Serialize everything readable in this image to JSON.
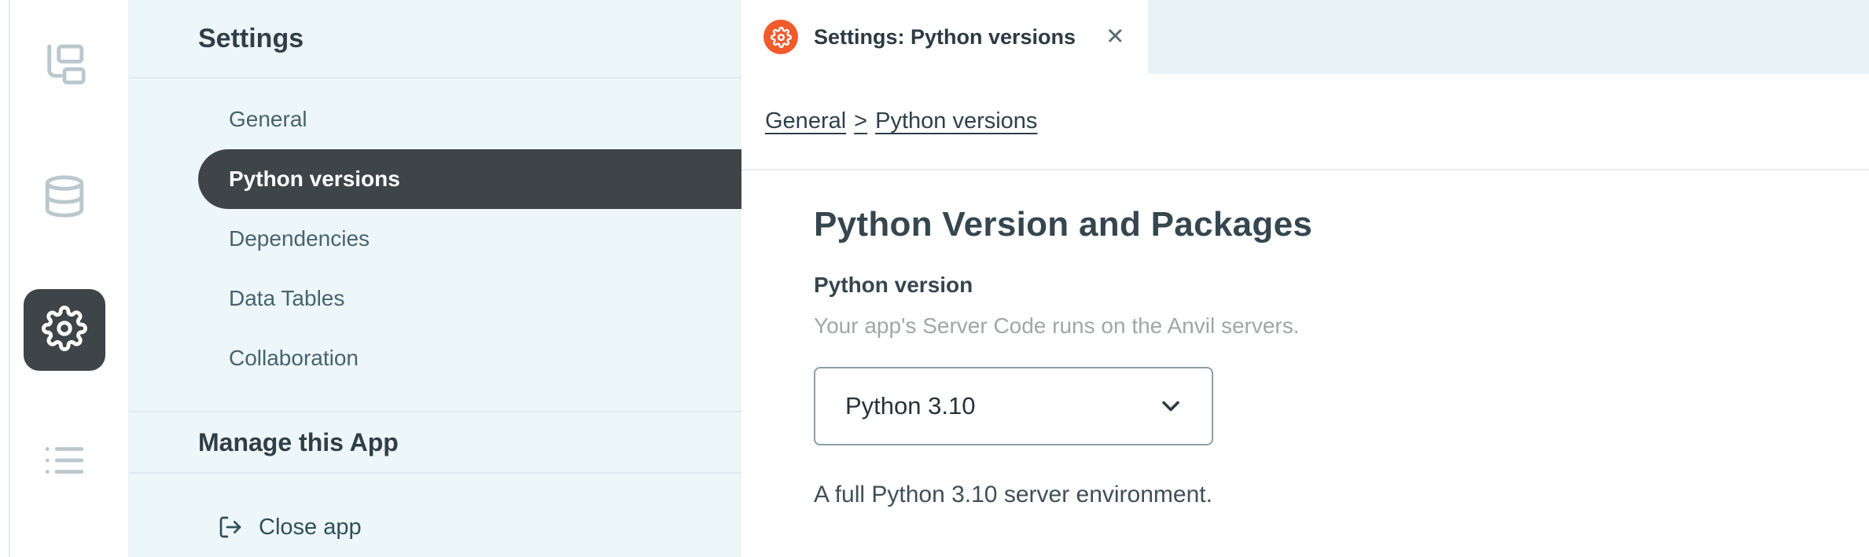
{
  "colors": {
    "accent_orange": "#F15B2B",
    "active_item_bg": "#3F4449",
    "sidebar_bg": "#EDF6F9",
    "tabbar_bg": "#E7F3F7"
  },
  "rail": {
    "items": [
      {
        "id": "app-structure",
        "icon": "app-structure-icon",
        "active": false
      },
      {
        "id": "database",
        "icon": "database-icon",
        "active": false
      },
      {
        "id": "settings",
        "icon": "gear-icon",
        "active": true
      },
      {
        "id": "logs",
        "icon": "list-icon",
        "active": false
      }
    ]
  },
  "sidebar": {
    "title": "Settings",
    "items": [
      {
        "label": "General",
        "active": false
      },
      {
        "label": "Python versions",
        "active": true
      },
      {
        "label": "Dependencies",
        "active": false
      },
      {
        "label": "Data Tables",
        "active": false
      },
      {
        "label": "Collaboration",
        "active": false
      }
    ],
    "section_title": "Manage this App",
    "close_app_label": "Close app"
  },
  "tabbar": {
    "active_tab": {
      "title": "Settings: Python versions",
      "close_glyph": "✕"
    }
  },
  "content": {
    "breadcrumb": {
      "parts": [
        "General",
        "Python versions"
      ],
      "separator": ">"
    },
    "heading": "Python Version and Packages",
    "python_version": {
      "label": "Python version",
      "help": "Your app's Server Code runs on the Anvil servers.",
      "selected": "Python 3.10",
      "description": "A full Python 3.10 server environment."
    }
  }
}
